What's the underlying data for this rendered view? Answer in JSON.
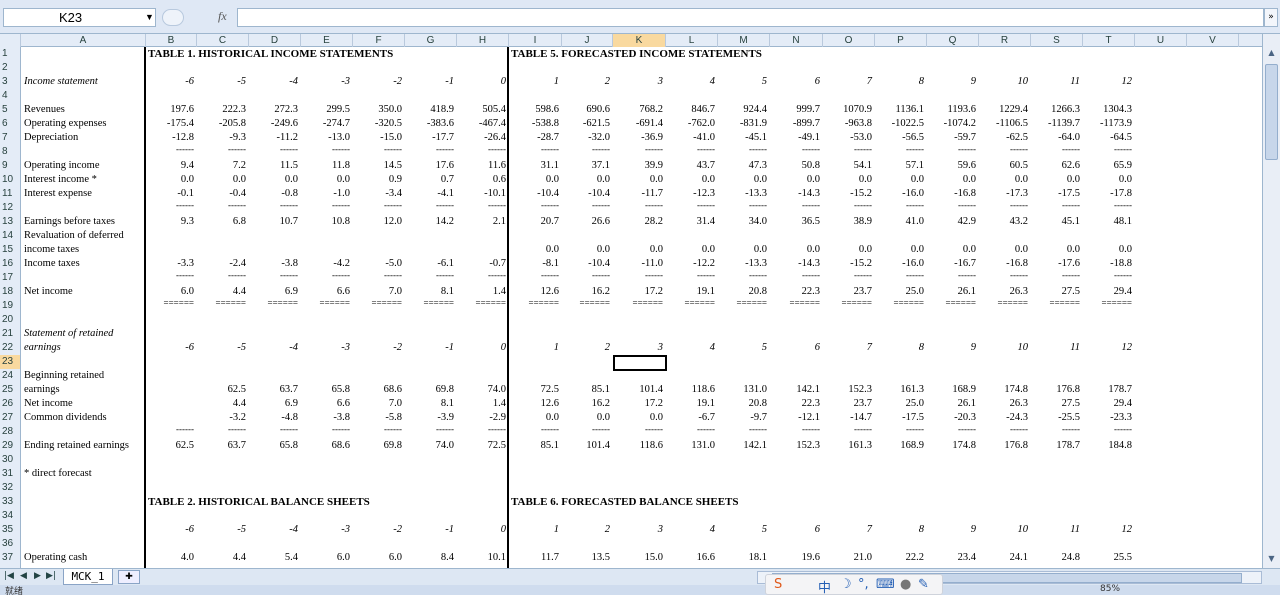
{
  "formula_bar": {
    "cell_ref": "K23",
    "fx": "fx",
    "formula": ""
  },
  "columns": [
    "A",
    "B",
    "C",
    "D",
    "E",
    "F",
    "G",
    "H",
    "I",
    "J",
    "K",
    "L",
    "M",
    "N",
    "O",
    "P",
    "Q",
    "R",
    "S",
    "T",
    "U",
    "V"
  ],
  "active_column": "K",
  "active_row": 23,
  "row_count": 37,
  "sheet_tab": "MCK_1",
  "status": {
    "left": "就绪",
    "zoom": "85%"
  },
  "headers": {
    "t1": "TABLE 1. HISTORICAL INCOME STATEMENTS",
    "t5": "TABLE 5. FORECASTED INCOME STATEMENTS",
    "t2": "TABLE 2. HISTORICAL BALANCE SHEETS",
    "t6": "TABLE 6. FORECASTED BALANCE SHEETS"
  },
  "years": [
    "-6",
    "-5",
    "-4",
    "-3",
    "-2",
    "-1",
    "0",
    "1",
    "2",
    "3",
    "4",
    "5",
    "6",
    "7",
    "8",
    "9",
    "10",
    "11",
    "12"
  ],
  "rows": [
    {
      "r": 3,
      "label": "Income statement",
      "italic": true,
      "years": true
    },
    {
      "r": 5,
      "label": "Revenues",
      "v": [
        "197.6",
        "222.3",
        "272.3",
        "299.5",
        "350.0",
        "418.9",
        "505.4",
        "598.6",
        "690.6",
        "768.2",
        "846.7",
        "924.4",
        "999.7",
        "1070.9",
        "1136.1",
        "1193.6",
        "1229.4",
        "1266.3",
        "1304.3"
      ]
    },
    {
      "r": 6,
      "label": "Operating expenses",
      "v": [
        "-175.4",
        "-205.8",
        "-249.6",
        "-274.7",
        "-320.5",
        "-383.6",
        "-467.4",
        "-538.8",
        "-621.5",
        "-691.4",
        "-762.0",
        "-831.9",
        "-899.7",
        "-963.8",
        "-1022.5",
        "-1074.2",
        "-1106.5",
        "-1139.7",
        "-1173.9"
      ]
    },
    {
      "r": 7,
      "label": "Depreciation",
      "v": [
        "-12.8",
        "-9.3",
        "-11.2",
        "-13.0",
        "-15.0",
        "-17.7",
        "-26.4",
        "-28.7",
        "-32.0",
        "-36.9",
        "-41.0",
        "-45.1",
        "-49.1",
        "-53.0",
        "-56.5",
        "-59.7",
        "-62.5",
        "-64.0",
        "-64.5"
      ]
    },
    {
      "r": 8,
      "dash": "------"
    },
    {
      "r": 9,
      "label": "Operating income",
      "v": [
        "9.4",
        "7.2",
        "11.5",
        "11.8",
        "14.5",
        "17.6",
        "11.6",
        "31.1",
        "37.1",
        "39.9",
        "43.7",
        "47.3",
        "50.8",
        "54.1",
        "57.1",
        "59.6",
        "60.5",
        "62.6",
        "65.9"
      ]
    },
    {
      "r": 10,
      "label": "Interest income *",
      "v": [
        "0.0",
        "0.0",
        "0.0",
        "0.0",
        "0.9",
        "0.7",
        "0.6",
        "0.0",
        "0.0",
        "0.0",
        "0.0",
        "0.0",
        "0.0",
        "0.0",
        "0.0",
        "0.0",
        "0.0",
        "0.0",
        "0.0"
      ]
    },
    {
      "r": 11,
      "label": "Interest expense",
      "v": [
        "-0.1",
        "-0.4",
        "-0.8",
        "-1.0",
        "-3.4",
        "-4.1",
        "-10.1",
        "-10.4",
        "-10.4",
        "-11.7",
        "-12.3",
        "-13.3",
        "-14.3",
        "-15.2",
        "-16.0",
        "-16.8",
        "-17.3",
        "-17.5",
        "-17.8"
      ]
    },
    {
      "r": 12,
      "dash": "------"
    },
    {
      "r": 13,
      "label": "Earnings before  taxes",
      "v": [
        "9.3",
        "6.8",
        "10.7",
        "10.8",
        "12.0",
        "14.2",
        "2.1",
        "20.7",
        "26.6",
        "28.2",
        "31.4",
        "34.0",
        "36.5",
        "38.9",
        "41.0",
        "42.9",
        "43.2",
        "45.1",
        "48.1"
      ]
    },
    {
      "r": 14,
      "label": "Revaluation of deferred"
    },
    {
      "r": 15,
      "label": "  income taxes",
      "v": [
        "",
        "",
        "",
        "",
        "",
        "",
        "",
        "0.0",
        "0.0",
        "0.0",
        "0.0",
        "0.0",
        "0.0",
        "0.0",
        "0.0",
        "0.0",
        "0.0",
        "0.0",
        "0.0"
      ]
    },
    {
      "r": 16,
      "label": "Income taxes",
      "v": [
        "-3.3",
        "-2.4",
        "-3.8",
        "-4.2",
        "-5.0",
        "-6.1",
        "-0.7",
        "-8.1",
        "-10.4",
        "-11.0",
        "-12.2",
        "-13.3",
        "-14.3",
        "-15.2",
        "-16.0",
        "-16.7",
        "-16.8",
        "-17.6",
        "-18.8"
      ]
    },
    {
      "r": 17,
      "dash": "------"
    },
    {
      "r": 18,
      "label": "Net income",
      "v": [
        "6.0",
        "4.4",
        "6.9",
        "6.6",
        "7.0",
        "8.1",
        "1.4",
        "12.6",
        "16.2",
        "17.2",
        "19.1",
        "20.8",
        "22.3",
        "23.7",
        "25.0",
        "26.1",
        "26.3",
        "27.5",
        "29.4"
      ]
    },
    {
      "r": 19,
      "dash": "======"
    },
    {
      "r": 21,
      "label": "Statement of retained",
      "italic": true
    },
    {
      "r": 22,
      "label": "earnings",
      "italic": true,
      "years": true
    },
    {
      "r": 24,
      "label": "Beginning retained"
    },
    {
      "r": 25,
      "label": "  earnings",
      "v": [
        "",
        "62.5",
        "63.7",
        "65.8",
        "68.6",
        "69.8",
        "74.0",
        "72.5",
        "85.1",
        "101.4",
        "118.6",
        "131.0",
        "142.1",
        "152.3",
        "161.3",
        "168.9",
        "174.8",
        "176.8",
        "178.7"
      ]
    },
    {
      "r": 26,
      "label": "Net income",
      "v": [
        "",
        "4.4",
        "6.9",
        "6.6",
        "7.0",
        "8.1",
        "1.4",
        "12.6",
        "16.2",
        "17.2",
        "19.1",
        "20.8",
        "22.3",
        "23.7",
        "25.0",
        "26.1",
        "26.3",
        "27.5",
        "29.4"
      ]
    },
    {
      "r": 27,
      "label": "Common dividends",
      "v": [
        "",
        "-3.2",
        "-4.8",
        "-3.8",
        "-5.8",
        "-3.9",
        "-2.9",
        "0.0",
        "0.0",
        "0.0",
        "-6.7",
        "-9.7",
        "-12.1",
        "-14.7",
        "-17.5",
        "-20.3",
        "-24.3",
        "-25.5",
        "-23.3"
      ]
    },
    {
      "r": 28,
      "dash": "------"
    },
    {
      "r": 29,
      "label": "Ending retained earnings",
      "v": [
        "62.5",
        "63.7",
        "65.8",
        "68.6",
        "69.8",
        "74.0",
        "72.5",
        "85.1",
        "101.4",
        "118.6",
        "131.0",
        "142.1",
        "152.3",
        "161.3",
        "168.9",
        "174.8",
        "176.8",
        "178.7",
        "184.8"
      ]
    },
    {
      "r": 31,
      "label": "* direct forecast"
    },
    {
      "r": 35,
      "years": true
    },
    {
      "r": 37,
      "label": "Operating cash",
      "v": [
        "4.0",
        "4.4",
        "5.4",
        "6.0",
        "6.0",
        "8.4",
        "10.1",
        "11.7",
        "13.5",
        "15.0",
        "16.6",
        "18.1",
        "19.6",
        "21.0",
        "22.2",
        "23.4",
        "24.1",
        "24.8",
        "25.5"
      ]
    }
  ]
}
